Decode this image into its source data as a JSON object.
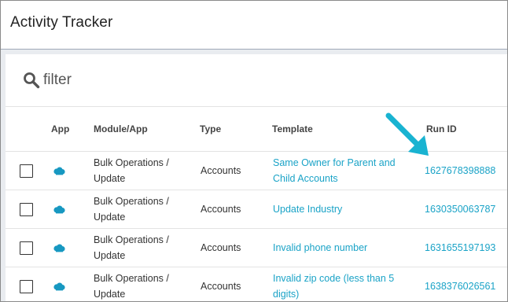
{
  "title": "Activity Tracker",
  "search": {
    "placeholder": "filter"
  },
  "columns": [
    "App",
    "Module/App",
    "Type",
    "Template",
    "Run ID"
  ],
  "rows": [
    {
      "app_icon": "salesforce-cloud-icon",
      "module_line1": "Bulk Operations /",
      "module_line2": "Update",
      "type": "Accounts",
      "template_line1": "Same Owner for Parent and",
      "template_line2": "Child Accounts",
      "run_id": "1627678398888"
    },
    {
      "app_icon": "salesforce-cloud-icon",
      "module_line1": "Bulk Operations /",
      "module_line2": "Update",
      "type": "Accounts",
      "template_line1": "Update Industry",
      "template_line2": "",
      "run_id": "1630350063787"
    },
    {
      "app_icon": "salesforce-cloud-icon",
      "module_line1": "Bulk Operations /",
      "module_line2": "Update",
      "type": "Accounts",
      "template_line1": "Invalid phone number",
      "template_line2": "",
      "run_id": "1631655197193"
    },
    {
      "app_icon": "salesforce-cloud-icon",
      "module_line1": "Bulk Operations /",
      "module_line2": "Update",
      "type": "Accounts",
      "template_line1": "Invalid zip code (less than 5",
      "template_line2": "digits)",
      "run_id": "1638376026561"
    }
  ],
  "colors": {
    "link": "#1aa3c7",
    "cloud": "#1798c1",
    "arrow": "#19b3d1",
    "background": "#e9ecf0"
  }
}
